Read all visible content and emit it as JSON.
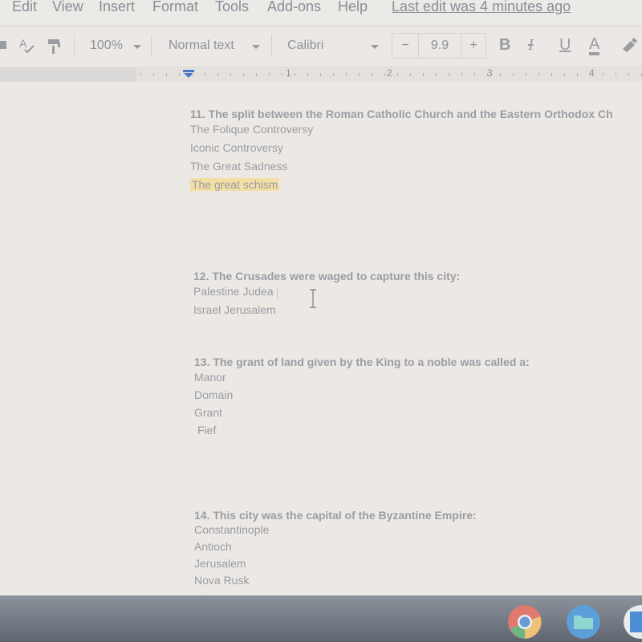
{
  "menubar": {
    "items": [
      "Edit",
      "View",
      "Insert",
      "Format",
      "Tools",
      "Add-ons",
      "Help"
    ],
    "last_edit": "Last edit was 4 minutes ago"
  },
  "toolbar": {
    "zoom": "100%",
    "style": "Normal text",
    "font": "Calibri",
    "font_size": "9.9",
    "decrease": "−",
    "increase": "+",
    "bold": "B",
    "italic": "I",
    "underline": "U",
    "text_color": "A",
    "icons": [
      "spellcheck-icon",
      "paint-format-icon",
      "highlight-pen-icon"
    ]
  },
  "ruler": {
    "labels": [
      "1",
      "2",
      "3",
      "4"
    ]
  },
  "document": {
    "questions": [
      {
        "prompt": "11. The split between the Roman Catholic Church and the Eastern Orthodox Ch",
        "options": [
          "The Folique Controversy",
          "Iconic Controversy",
          "The Great Sadness",
          "The great schism"
        ],
        "highlighted": "The great schism"
      },
      {
        "prompt": "12. The Crusades were waged to capture this city:",
        "options": [
          "Palestine Judea",
          "Israel Jerusalem"
        ]
      },
      {
        "prompt": "13. The grant of land given by the King to a noble was called a:",
        "options": [
          "Manor",
          "Domain",
          "Grant",
          "Fief"
        ]
      },
      {
        "prompt": "14. This city was the capital of the Byzantine Empire:",
        "options": [
          "Constantinople",
          "Antioch",
          "Jerusalem",
          "Nova Rusk"
        ]
      }
    ],
    "highlight_color": "#f3dfa4"
  },
  "taskbar": {
    "apps": [
      "chrome-icon",
      "files-icon",
      "docs-icon"
    ]
  }
}
